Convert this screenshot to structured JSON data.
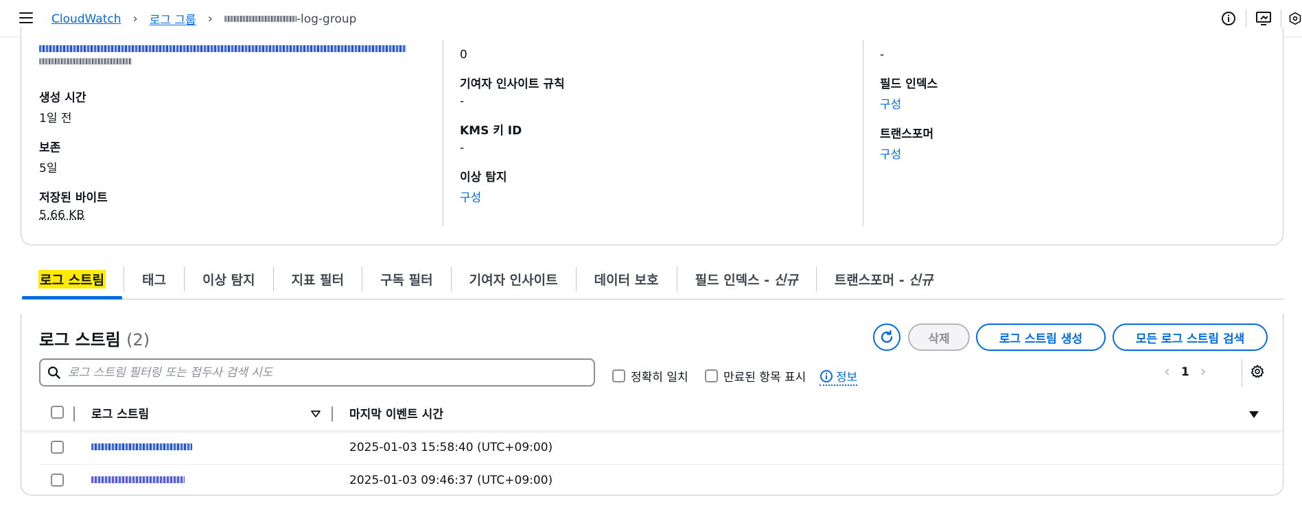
{
  "breadcrumb": {
    "items": [
      {
        "label": "CloudWatch"
      },
      {
        "label": "로그 그룹"
      }
    ],
    "current_suffix": "-log-group"
  },
  "details": {
    "col1": {
      "created_label": "생성 시간",
      "created_value": "1일 전",
      "retention_label": "보존",
      "retention_value": "5일",
      "stored_label": "저장된 바이트",
      "stored_value": "5.66 KB"
    },
    "col2": {
      "top_value": "0",
      "contributor_label": "기여자 인사이트 규칙",
      "contributor_value": "-",
      "kms_label": "KMS 키 ID",
      "kms_value": "-",
      "anomaly_label": "이상 탐지",
      "anomaly_link": "구성"
    },
    "col3": {
      "top_value": "-",
      "field_index_label": "필드 인덱스",
      "field_index_link": "구성",
      "transformer_label": "트랜스포머",
      "transformer_link": "구성"
    }
  },
  "tabs": [
    {
      "label": "로그 스트림",
      "active": true
    },
    {
      "label": "태그"
    },
    {
      "label": "이상 탐지"
    },
    {
      "label": "지표 필터"
    },
    {
      "label": "구독 필터"
    },
    {
      "label": "기여자 인사이트"
    },
    {
      "label": "데이터 보호"
    },
    {
      "label": "필드 인덱스 - ",
      "italic": "신규"
    },
    {
      "label": "트랜스포머 - ",
      "italic": "신규"
    }
  ],
  "streams": {
    "title": "로그 스트림",
    "count": "(2)",
    "delete_label": "삭제",
    "create_label": "로그 스트림 생성",
    "search_all_label": "모든 로그 스트림 검색",
    "search_placeholder": "로그 스트림 필터링 또는 접두사 검색 시도",
    "exact_match_label": "정확히 일치",
    "show_expired_label": "만료된 항목 표시",
    "info_label": "정보",
    "page": "1",
    "columns": {
      "stream": "로그 스트림",
      "last_event": "마지막 이벤트 시간"
    },
    "rows": [
      {
        "time": "2025-01-03 15:58:40 (UTC+09:00)"
      },
      {
        "time": "2025-01-03 09:46:37 (UTC+09:00)"
      }
    ]
  },
  "icons": {
    "menu": "hamburger-icon",
    "info": "info-icon",
    "notifications": "screen-icon",
    "settings": "hexagon-icon",
    "refresh": "refresh-icon",
    "search": "search-icon",
    "gear": "gear-icon"
  },
  "colors": {
    "link": "#006ce0",
    "highlight": "#ffeb00",
    "border": "#c6c6cd"
  }
}
